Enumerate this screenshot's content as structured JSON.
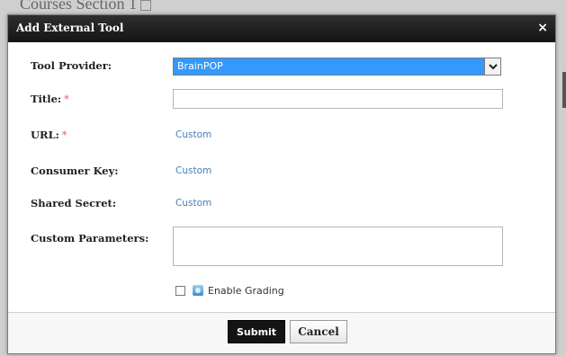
{
  "background": {
    "heading": "Courses Section 1"
  },
  "dialog": {
    "title": "Add External Tool",
    "close_label": "×",
    "required_mark": "*",
    "fields": {
      "tool_provider": {
        "label": "Tool Provider:",
        "selected": "BrainPOP"
      },
      "title": {
        "label": "Title:",
        "value": ""
      },
      "url": {
        "label": "URL:",
        "link": "Custom"
      },
      "consumer_key": {
        "label": "Consumer Key:",
        "link": "Custom"
      },
      "shared_secret": {
        "label": "Shared Secret:",
        "link": "Custom"
      },
      "custom_parameters": {
        "label": "Custom Parameters:",
        "value": ""
      }
    },
    "grading": {
      "label": "Enable Grading",
      "checked": false,
      "icon": "grading-icon"
    },
    "buttons": {
      "submit": "Submit",
      "cancel": "Cancel"
    }
  },
  "colors": {
    "titlebar": "#1e1e1e",
    "select_highlight": "#3399ff",
    "link": "#4a7fb5",
    "required": "#e05a5a",
    "submit_bg": "#141414"
  }
}
